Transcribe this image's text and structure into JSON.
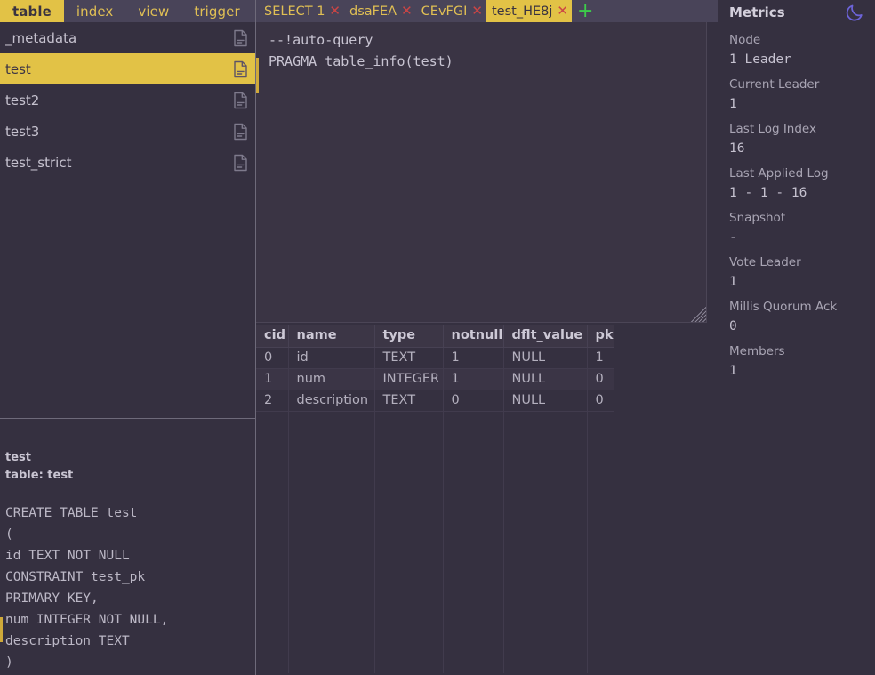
{
  "sidebar": {
    "tabs": [
      {
        "label": "table",
        "active": true
      },
      {
        "label": "index",
        "active": false
      },
      {
        "label": "view",
        "active": false
      },
      {
        "label": "trigger",
        "active": false
      }
    ],
    "items": [
      {
        "label": "_metadata",
        "selected": false
      },
      {
        "label": "test",
        "selected": true
      },
      {
        "label": "test2",
        "selected": false
      },
      {
        "label": "test3",
        "selected": false
      },
      {
        "label": "test_strict",
        "selected": false
      }
    ]
  },
  "ddl": {
    "name": "test",
    "kind": "table: test",
    "sql": "CREATE TABLE test\n(\nid TEXT NOT NULL\nCONSTRAINT test_pk\nPRIMARY KEY,\nnum INTEGER NOT NULL,\ndescription TEXT\n)"
  },
  "editor": {
    "tabs": [
      {
        "label": "SELECT 1",
        "active": false,
        "close": "✕"
      },
      {
        "label": "dsaFEA",
        "active": false,
        "close": "✕"
      },
      {
        "label": "CEvFGI",
        "active": false,
        "close": "✕"
      },
      {
        "label": "test_HE8j",
        "active": true,
        "close": "✕"
      }
    ],
    "add_tab": "+",
    "query": "--!auto-query\nPRAGMA table_info(test)"
  },
  "results": {
    "columns": [
      "cid",
      "name",
      "type",
      "notnull",
      "dflt_value",
      "pk"
    ],
    "rows": [
      [
        "0",
        "id",
        "TEXT",
        "1",
        "NULL",
        "1"
      ],
      [
        "1",
        "num",
        "INTEGER",
        "1",
        "NULL",
        "0"
      ],
      [
        "2",
        "description",
        "TEXT",
        "0",
        "NULL",
        "0"
      ]
    ]
  },
  "metrics": {
    "title": "Metrics",
    "theme_toggle": "moon-icon",
    "items": [
      {
        "label": "Node",
        "value": "1  Leader"
      },
      {
        "label": "Current Leader",
        "value": "1"
      },
      {
        "label": "Last Log Index",
        "value": "16"
      },
      {
        "label": "Last Applied Log",
        "value": "1 - 1 - 16"
      },
      {
        "label": "Snapshot",
        "value": "-"
      },
      {
        "label": "Vote Leader",
        "value": "1"
      },
      {
        "label": "Millis Quorum Ack",
        "value": "0"
      },
      {
        "label": "Members",
        "value": "1"
      }
    ]
  },
  "colors": {
    "background": "#353040",
    "panel_header": "#494459",
    "accent": "#e2c246",
    "accent_text": "#e0bf54",
    "close_red": "#cc4545",
    "add_green": "#3ccc4a",
    "moon_purple": "#6c63d8",
    "text": "#b8b4c0"
  }
}
